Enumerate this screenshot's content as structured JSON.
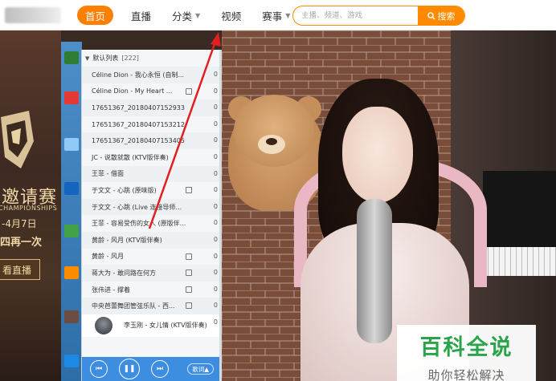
{
  "header": {
    "nav": [
      {
        "label": "首页",
        "active": true,
        "dropdown": false
      },
      {
        "label": "直播",
        "active": false,
        "dropdown": false
      },
      {
        "label": "分类",
        "active": false,
        "dropdown": true
      },
      {
        "label": "视频",
        "active": false,
        "dropdown": false
      },
      {
        "label": "赛事",
        "active": false,
        "dropdown": true
      }
    ],
    "search": {
      "placeholder": "主播、频道、游戏",
      "button_label": "搜索"
    },
    "accent": "#ff7f00"
  },
  "banner": {
    "title": "邀请赛",
    "subtitle": "CHAMPIONSHIPS",
    "date": "-4月7日",
    "once": "四再一次",
    "watch_label": "看直播"
  },
  "playlist": {
    "header": "默认列表",
    "count": "[222]",
    "tracks": [
      {
        "title": "Céline Dion - 我心永恒 (自制...",
        "mv": false,
        "num": "0"
      },
      {
        "title": "Céline Dion - My Heart ...",
        "mv": true,
        "num": "0"
      },
      {
        "title": "17651367_20180407152933",
        "mv": false,
        "num": "0"
      },
      {
        "title": "17651367_20180407153212",
        "mv": false,
        "num": "0"
      },
      {
        "title": "17651367_20180407153405",
        "mv": false,
        "num": "0"
      },
      {
        "title": "JC - 说散就散 (KTV版伴奏)",
        "mv": false,
        "num": "0"
      },
      {
        "title": "王菲 - 借面",
        "mv": false,
        "num": "0"
      },
      {
        "title": "于文文 - 心跳 (原味版)",
        "mv": true,
        "num": "0"
      },
      {
        "title": "于文文 - 心跳 (Live 连接导师...",
        "mv": false,
        "num": "0"
      },
      {
        "title": "王菲 - 容易受伤的女人 (原版伴...",
        "mv": false,
        "num": "0"
      },
      {
        "title": "黄龄 - 风月 (KTV版伴奏)",
        "mv": false,
        "num": "0"
      },
      {
        "title": "黄龄 - 风月",
        "mv": true,
        "num": "0"
      },
      {
        "title": "蒋大为 - 敢问路在何方",
        "mv": true,
        "num": "0"
      },
      {
        "title": "张伟进 - 撑着",
        "mv": true,
        "num": "0"
      },
      {
        "title": "中央芭蕾舞团管弦乐队 - 西...",
        "mv": true,
        "num": "0"
      }
    ],
    "current": {
      "title": "李玉刚 - 女儿情 (KTV版伴奏)",
      "num": "0"
    },
    "lyric_label": "歌词"
  },
  "watermark": {
    "title": "百科全说",
    "subtitle": "助你轻松解决"
  },
  "icons": {
    "search": "search-icon",
    "prev": "previous-icon",
    "pause": "pause-icon",
    "next": "next-icon",
    "collapse": "chevron-down-icon"
  }
}
